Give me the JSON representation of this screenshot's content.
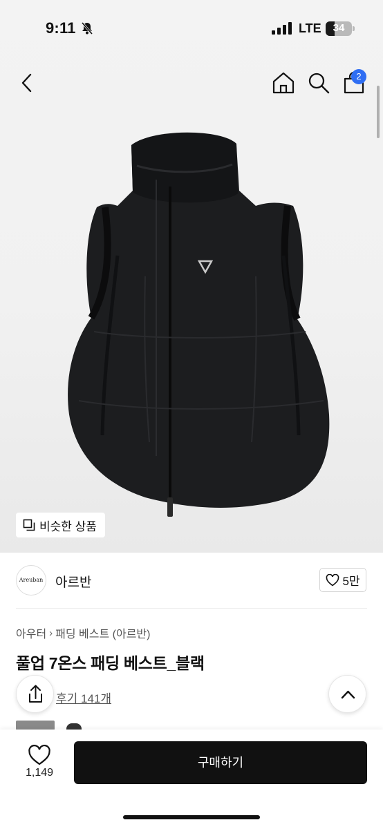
{
  "status_bar": {
    "time": "9:11",
    "network": "LTE",
    "battery": "34"
  },
  "nav": {
    "cart_count": "2"
  },
  "hero": {
    "similar_label": "비슷한 상품"
  },
  "brand": {
    "logo_text": "Areuban",
    "name": "아르반",
    "like_label": "5만"
  },
  "product": {
    "breadcrumb": [
      "아우터",
      "패딩 베스트 (아르반)"
    ],
    "title": "풀업 7온스 패딩 베스트_블랙",
    "reviews": "후기 141개"
  },
  "bottom_bar": {
    "like_count": "1,149",
    "buy_label": "구매하기"
  },
  "colors": {
    "accent": "#2f6ef3",
    "buy_button": "#111111"
  }
}
